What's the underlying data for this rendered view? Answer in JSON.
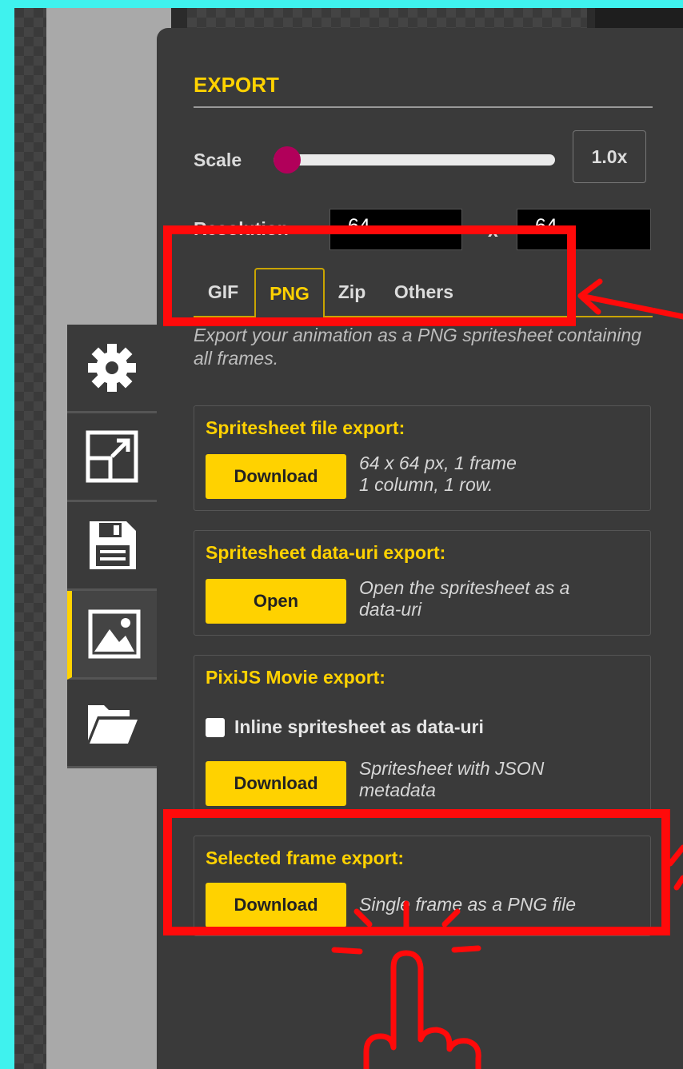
{
  "panel": {
    "title": "EXPORT",
    "scale_label": "Scale",
    "scale_value": "1.0x",
    "scale_fraction": 0.0,
    "resolution_label": "Resolution",
    "resolution_width": "64",
    "resolution_sep": "x",
    "resolution_height": "64",
    "tabs": [
      {
        "label": "GIF"
      },
      {
        "label": "PNG"
      },
      {
        "label": "Zip"
      },
      {
        "label": "Others"
      }
    ],
    "active_tab": "PNG",
    "description": "Export your animation as a PNG spritesheet containing all frames."
  },
  "sections": {
    "file": {
      "title": "Spritesheet file export:",
      "button": "Download",
      "info_line1": "64 x 64 px, 1 frame",
      "info_line2": "1 column, 1 row."
    },
    "datauri": {
      "title": "Spritesheet data-uri export:",
      "button": "Open",
      "info_line1": "Open the spritesheet as a",
      "info_line2": "data-uri"
    },
    "pixi": {
      "title": "PixiJS Movie export:",
      "checkbox_label": "Inline spritesheet as data-uri",
      "checkbox_checked": false,
      "button": "Download",
      "info_line1": "Spritesheet with JSON",
      "info_line2": "metadata"
    },
    "selected": {
      "title": "Selected frame export:",
      "button": "Download",
      "info": "Single frame as a PNG file"
    }
  },
  "toolbar": {
    "items": [
      {
        "icon": "gear-icon"
      },
      {
        "icon": "resize-icon"
      },
      {
        "icon": "save-icon"
      },
      {
        "icon": "image-icon"
      },
      {
        "icon": "folder-open-icon"
      }
    ],
    "active_index": 3
  },
  "colors": {
    "accent": "#ffd200",
    "annotation": "#ff0a0a",
    "panel_bg": "#3a3a3a",
    "slider_knob": "#b1005a",
    "page_bg": "#3ff2ee"
  }
}
